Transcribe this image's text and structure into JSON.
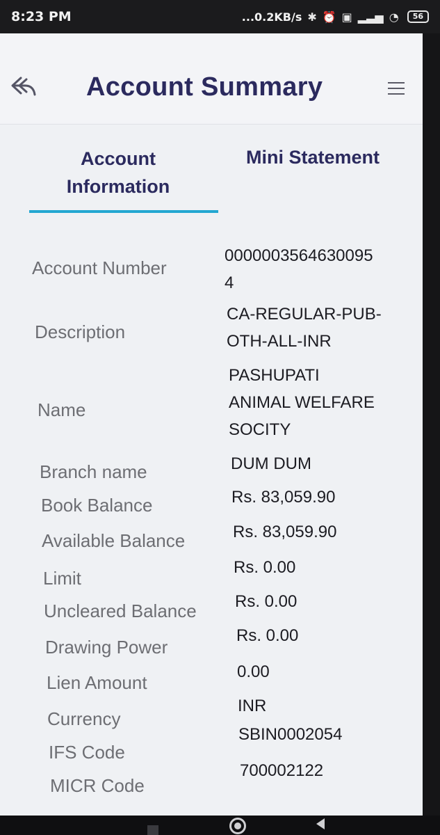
{
  "status_bar": {
    "time": "8:23 PM",
    "network_speed": "...0.2KB/s",
    "battery": "56",
    "icons": [
      "bluetooth-icon",
      "alarm-icon",
      "volte-icon",
      "signal-icon",
      "wifi-icon",
      "battery-icon"
    ]
  },
  "header": {
    "title": "Account Summary",
    "back_icon": "back-arrow-icon",
    "menu_icon": "hamburger-menu-icon"
  },
  "tabs": [
    {
      "label": "Account Information",
      "selected": true
    },
    {
      "label": "Mini Statement",
      "selected": false
    }
  ],
  "colors": {
    "title": "#2b2a5e",
    "tab_indicator": "#23a7d1",
    "label": "#6d6e73",
    "value": "#1c1c22"
  },
  "account_info": [
    {
      "label": "Account Number",
      "value_lines": [
        "0000003564630095",
        "4"
      ]
    },
    {
      "label": "Description",
      "value_lines": [
        "CA-REGULAR-PUB-",
        "OTH-ALL-INR"
      ]
    },
    {
      "label": "Name",
      "value_lines": [
        "PASHUPATI",
        "ANIMAL WELFARE",
        "SOCITY"
      ]
    },
    {
      "label": "Branch name",
      "value_lines": [
        "DUM DUM"
      ]
    },
    {
      "label": "Book Balance",
      "value_lines": [
        "Rs. 83,059.90"
      ]
    },
    {
      "label": "Available Balance",
      "value_lines": [
        "Rs. 83,059.90"
      ]
    },
    {
      "label": "Limit",
      "value_lines": [
        "Rs. 0.00"
      ]
    },
    {
      "label": "Uncleared Balance",
      "value_lines": [
        "Rs. 0.00"
      ]
    },
    {
      "label": "Drawing Power",
      "value_lines": [
        "Rs. 0.00"
      ]
    },
    {
      "label": "Lien Amount",
      "value_lines": [
        "0.00"
      ]
    },
    {
      "label": "Currency",
      "value_lines": [
        "INR"
      ]
    },
    {
      "label": "IFS Code",
      "value_lines": [
        "SBIN0002054"
      ]
    },
    {
      "label": "MICR Code",
      "value_lines": [
        "700002122"
      ]
    }
  ]
}
